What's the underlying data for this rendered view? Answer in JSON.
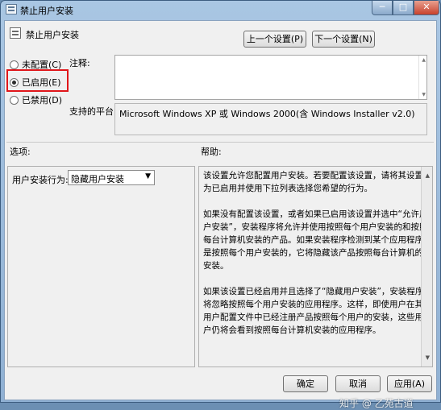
{
  "window": {
    "title": "禁止用户安装",
    "minimize_glyph": "─",
    "maximize_glyph": "□",
    "close_glyph": "✕"
  },
  "header": {
    "title": "禁止用户安装",
    "prev_label": "上一个设置(P)",
    "next_label": "下一个设置(N)"
  },
  "state": {
    "options": [
      {
        "label": "未配置(C)",
        "checked": false
      },
      {
        "label": "已启用(E)",
        "checked": true
      },
      {
        "label": "已禁用(D)",
        "checked": false
      }
    ]
  },
  "comment": {
    "label": "注释:",
    "value": ""
  },
  "platform": {
    "label": "支持的平台:",
    "value": "Microsoft Windows XP 或 Windows 2000(含 Windows Installer v2.0)"
  },
  "sections": {
    "options_label": "选项:",
    "help_label": "帮助:"
  },
  "options": {
    "field_label": "用户安装行为:",
    "selected": "隐藏用户安装"
  },
  "help": {
    "paragraphs": [
      "该设置允许您配置用户安装。若要配置该设置，请将其设置为已启用并使用下拉列表选择您希望的行为。",
      "如果没有配置该设置，或者如果已启用该设置并选中“允许用户安装”，安装程序将允许并使用按照每个用户安装的和按照每台计算机安装的产品。如果安装程序检测到某个应用程序是按照每个用户安装的，它将隐藏该产品按照每台计算机的安装。",
      "如果该设置已经启用并且选择了“隐藏用户安装”，安装程序将忽略按照每个用户安装的应用程序。这样，即使用户在其用户配置文件中已经注册产品按照每个用户的安装，这些用户仍将会看到按照每台计算机安装的应用程序。"
    ]
  },
  "footer": {
    "ok_label": "确定",
    "cancel_label": "取消",
    "apply_label": "应用(A)"
  },
  "watermark": "知乎 @ 乙苑古道"
}
